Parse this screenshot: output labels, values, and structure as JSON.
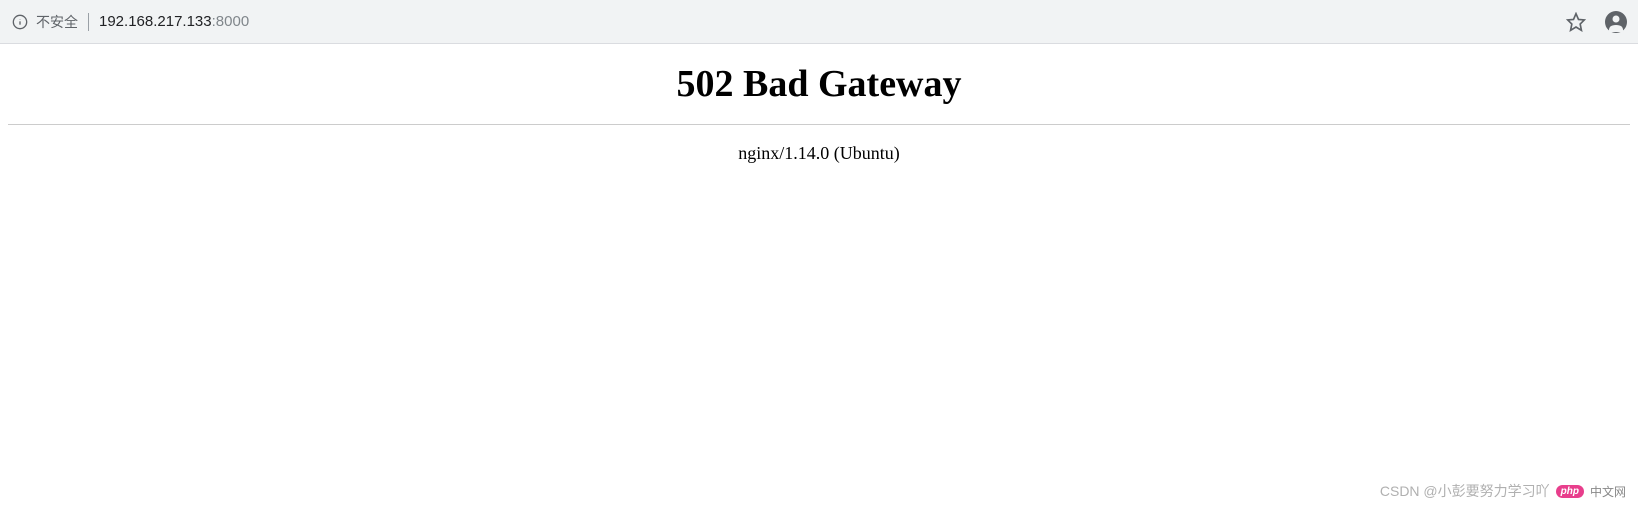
{
  "address_bar": {
    "security_label": "不安全",
    "url_host": "192.168.217.133",
    "url_port": ":8000"
  },
  "error_page": {
    "title": "502 Bad Gateway",
    "server_info": "nginx/1.14.0 (Ubuntu)"
  },
  "watermark": {
    "csdn_text": "CSDN @小彭要努力学习吖",
    "php_badge": "php",
    "cn_text": "中文网"
  }
}
